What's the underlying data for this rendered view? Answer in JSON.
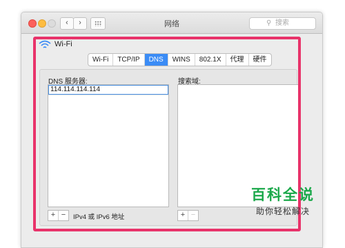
{
  "window": {
    "title": "网络"
  },
  "search": {
    "placeholder": "搜索"
  },
  "interface": {
    "name": "Wi-Fi"
  },
  "tabs": [
    "Wi-Fi",
    "TCP/IP",
    "DNS",
    "WINS",
    "802.1X",
    "代理",
    "硬件"
  ],
  "active_tab": "DNS",
  "dns": {
    "label": "DNS 服务器:",
    "servers": [
      "114.114.114.114"
    ],
    "hint": "IPv4 或 IPv6 地址"
  },
  "search_domains": {
    "label": "搜索域:",
    "items": []
  },
  "controls": {
    "add": "+",
    "remove": "−"
  },
  "watermark": {
    "title": "百科全说",
    "subtitle": "助你轻松解决"
  },
  "colors": {
    "highlight": "#e8336a",
    "active_tab": "#3b8cf6",
    "watermark_green": "#1aa84a"
  },
  "icons": {
    "wifi": "wifi-icon",
    "search": "search-icon",
    "back": "chevron-left-icon",
    "forward": "chevron-right-icon",
    "grid": "grid-icon"
  }
}
